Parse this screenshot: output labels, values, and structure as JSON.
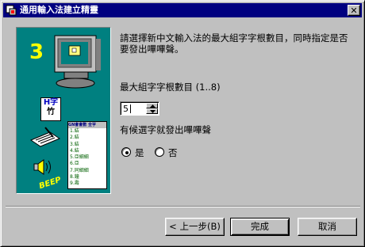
{
  "window": {
    "title": "通用輸入法建立精靈",
    "close_glyph": "✕"
  },
  "panel": {
    "step_number": "3",
    "beep_text": "BEEP",
    "hanzi_sample": "H字",
    "hanzi_bottom": "竹",
    "list_header": "GN會會數 全字",
    "list_items": [
      "1.結",
      "2.結",
      "3.結",
      "4.結",
      "5.亞細細",
      "6.亞",
      "7.同細細",
      "8.鐘",
      "9.壽"
    ]
  },
  "prompt": "請選擇新中文輸入法的最大組字字根數目，同時指定是否要發出嗶嗶聲。",
  "max_roots": {
    "label": "最大組字字根數目 (1..8)",
    "value": "5"
  },
  "beep_question": "有候選字就發出嗶嗶聲",
  "beep_options": [
    {
      "label": "是",
      "selected": true
    },
    {
      "label": "否",
      "selected": false
    }
  ],
  "buttons": {
    "back": "< 上一步(B)",
    "finish": "完成",
    "cancel": "取消"
  }
}
